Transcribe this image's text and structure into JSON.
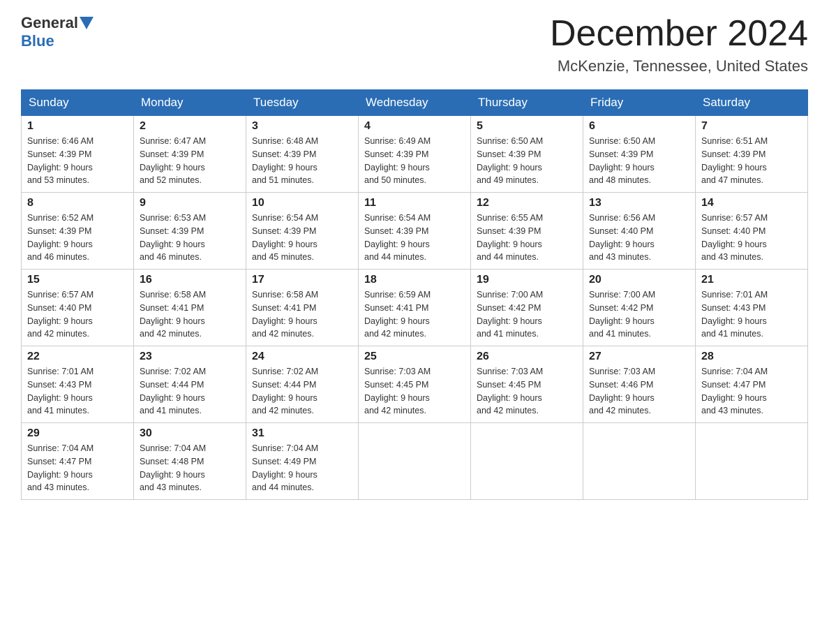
{
  "header": {
    "logo_general": "General",
    "logo_blue": "Blue",
    "month": "December 2024",
    "location": "McKenzie, Tennessee, United States"
  },
  "days_of_week": [
    "Sunday",
    "Monday",
    "Tuesday",
    "Wednesday",
    "Thursday",
    "Friday",
    "Saturday"
  ],
  "weeks": [
    [
      {
        "day": "1",
        "sunrise": "6:46 AM",
        "sunset": "4:39 PM",
        "daylight": "9 hours and 53 minutes."
      },
      {
        "day": "2",
        "sunrise": "6:47 AM",
        "sunset": "4:39 PM",
        "daylight": "9 hours and 52 minutes."
      },
      {
        "day": "3",
        "sunrise": "6:48 AM",
        "sunset": "4:39 PM",
        "daylight": "9 hours and 51 minutes."
      },
      {
        "day": "4",
        "sunrise": "6:49 AM",
        "sunset": "4:39 PM",
        "daylight": "9 hours and 50 minutes."
      },
      {
        "day": "5",
        "sunrise": "6:50 AM",
        "sunset": "4:39 PM",
        "daylight": "9 hours and 49 minutes."
      },
      {
        "day": "6",
        "sunrise": "6:50 AM",
        "sunset": "4:39 PM",
        "daylight": "9 hours and 48 minutes."
      },
      {
        "day": "7",
        "sunrise": "6:51 AM",
        "sunset": "4:39 PM",
        "daylight": "9 hours and 47 minutes."
      }
    ],
    [
      {
        "day": "8",
        "sunrise": "6:52 AM",
        "sunset": "4:39 PM",
        "daylight": "9 hours and 46 minutes."
      },
      {
        "day": "9",
        "sunrise": "6:53 AM",
        "sunset": "4:39 PM",
        "daylight": "9 hours and 46 minutes."
      },
      {
        "day": "10",
        "sunrise": "6:54 AM",
        "sunset": "4:39 PM",
        "daylight": "9 hours and 45 minutes."
      },
      {
        "day": "11",
        "sunrise": "6:54 AM",
        "sunset": "4:39 PM",
        "daylight": "9 hours and 44 minutes."
      },
      {
        "day": "12",
        "sunrise": "6:55 AM",
        "sunset": "4:39 PM",
        "daylight": "9 hours and 44 minutes."
      },
      {
        "day": "13",
        "sunrise": "6:56 AM",
        "sunset": "4:40 PM",
        "daylight": "9 hours and 43 minutes."
      },
      {
        "day": "14",
        "sunrise": "6:57 AM",
        "sunset": "4:40 PM",
        "daylight": "9 hours and 43 minutes."
      }
    ],
    [
      {
        "day": "15",
        "sunrise": "6:57 AM",
        "sunset": "4:40 PM",
        "daylight": "9 hours and 42 minutes."
      },
      {
        "day": "16",
        "sunrise": "6:58 AM",
        "sunset": "4:41 PM",
        "daylight": "9 hours and 42 minutes."
      },
      {
        "day": "17",
        "sunrise": "6:58 AM",
        "sunset": "4:41 PM",
        "daylight": "9 hours and 42 minutes."
      },
      {
        "day": "18",
        "sunrise": "6:59 AM",
        "sunset": "4:41 PM",
        "daylight": "9 hours and 42 minutes."
      },
      {
        "day": "19",
        "sunrise": "7:00 AM",
        "sunset": "4:42 PM",
        "daylight": "9 hours and 41 minutes."
      },
      {
        "day": "20",
        "sunrise": "7:00 AM",
        "sunset": "4:42 PM",
        "daylight": "9 hours and 41 minutes."
      },
      {
        "day": "21",
        "sunrise": "7:01 AM",
        "sunset": "4:43 PM",
        "daylight": "9 hours and 41 minutes."
      }
    ],
    [
      {
        "day": "22",
        "sunrise": "7:01 AM",
        "sunset": "4:43 PM",
        "daylight": "9 hours and 41 minutes."
      },
      {
        "day": "23",
        "sunrise": "7:02 AM",
        "sunset": "4:44 PM",
        "daylight": "9 hours and 41 minutes."
      },
      {
        "day": "24",
        "sunrise": "7:02 AM",
        "sunset": "4:44 PM",
        "daylight": "9 hours and 42 minutes."
      },
      {
        "day": "25",
        "sunrise": "7:03 AM",
        "sunset": "4:45 PM",
        "daylight": "9 hours and 42 minutes."
      },
      {
        "day": "26",
        "sunrise": "7:03 AM",
        "sunset": "4:45 PM",
        "daylight": "9 hours and 42 minutes."
      },
      {
        "day": "27",
        "sunrise": "7:03 AM",
        "sunset": "4:46 PM",
        "daylight": "9 hours and 42 minutes."
      },
      {
        "day": "28",
        "sunrise": "7:04 AM",
        "sunset": "4:47 PM",
        "daylight": "9 hours and 43 minutes."
      }
    ],
    [
      {
        "day": "29",
        "sunrise": "7:04 AM",
        "sunset": "4:47 PM",
        "daylight": "9 hours and 43 minutes."
      },
      {
        "day": "30",
        "sunrise": "7:04 AM",
        "sunset": "4:48 PM",
        "daylight": "9 hours and 43 minutes."
      },
      {
        "day": "31",
        "sunrise": "7:04 AM",
        "sunset": "4:49 PM",
        "daylight": "9 hours and 44 minutes."
      },
      null,
      null,
      null,
      null
    ]
  ],
  "labels": {
    "sunrise": "Sunrise:",
    "sunset": "Sunset:",
    "daylight": "Daylight:"
  }
}
